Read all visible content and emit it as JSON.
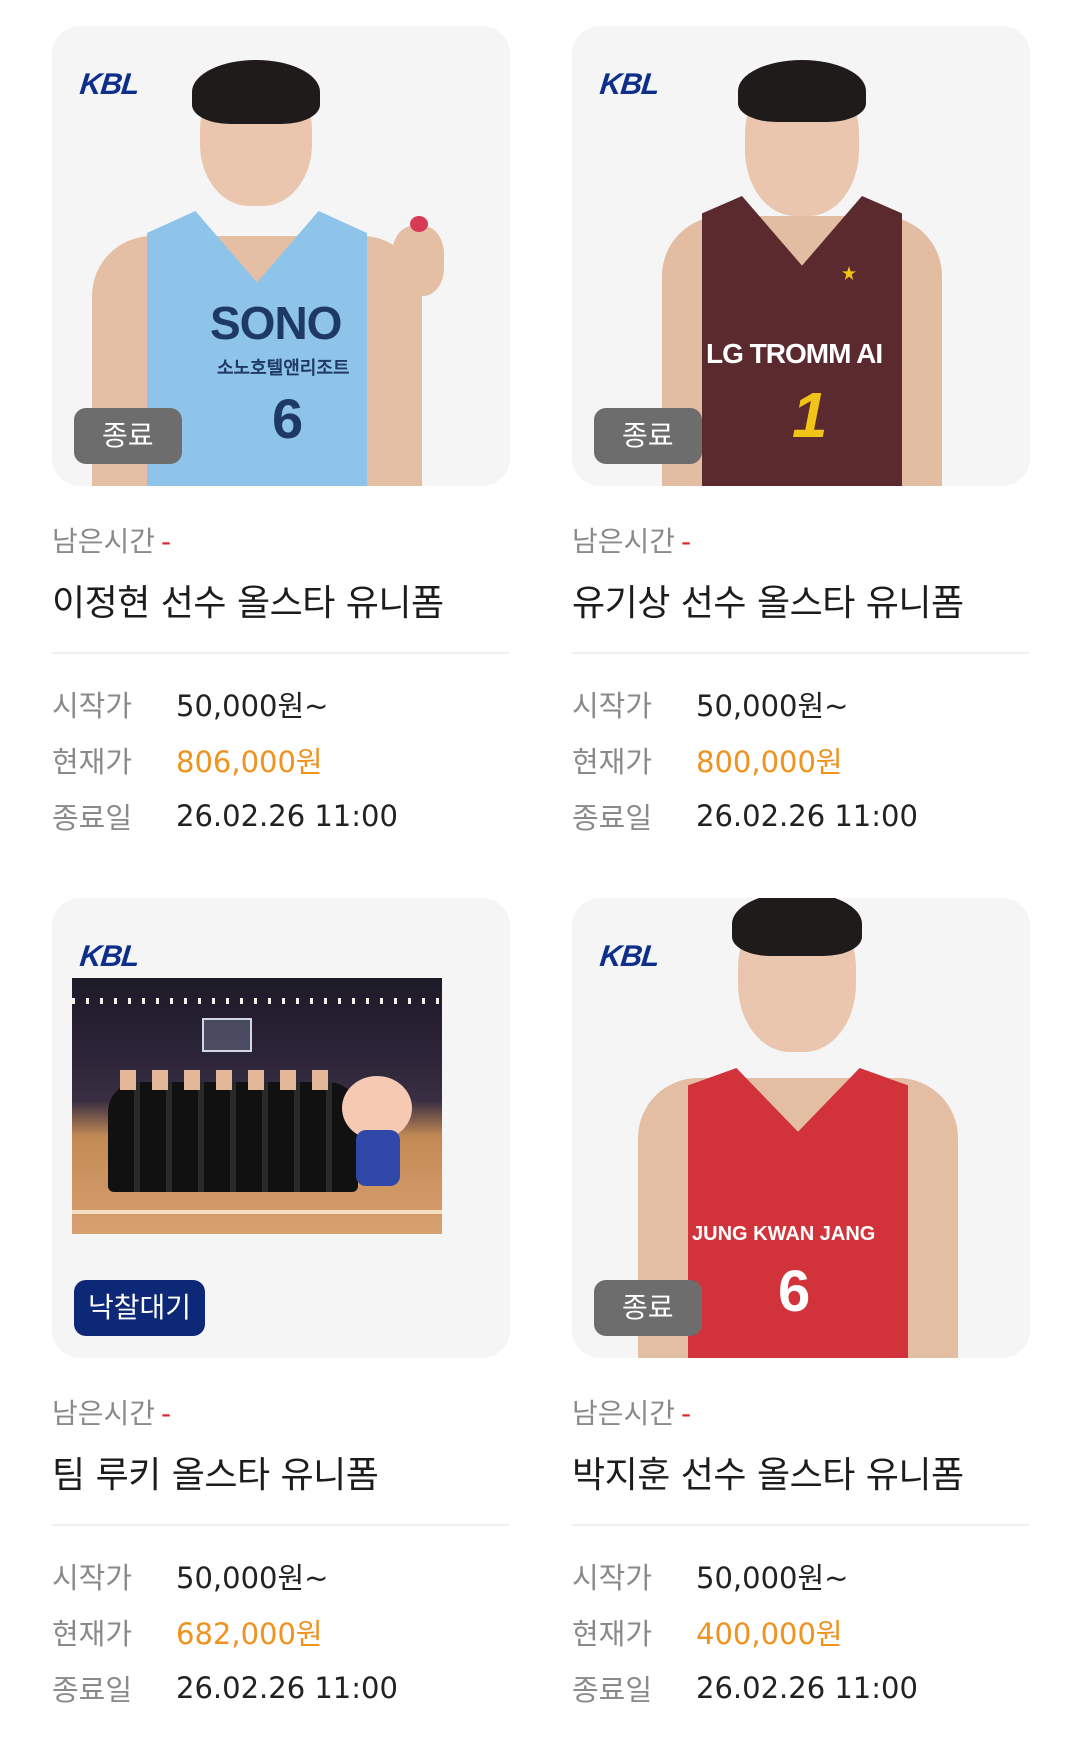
{
  "labels": {
    "remain": "남은시간",
    "remain_value": "-",
    "start_price": "시작가",
    "current_price": "현재가",
    "end_date": "종료일"
  },
  "logo_text": "KBL",
  "items": [
    {
      "badge": "종료",
      "title": "이정현 선수 올스타 유니폼",
      "start_price": "50,000원~",
      "current_price": "806,000원",
      "end_date": "26.02.26 11:00",
      "jersey_brand": "SONO",
      "jersey_sub": "소노호텔앤리조트",
      "jersey_number": "6",
      "jersey_color": "#8ec3ea"
    },
    {
      "badge": "종료",
      "title": "유기상 선수 올스타 유니폼",
      "start_price": "50,000원~",
      "current_price": "800,000원",
      "end_date": "26.02.26 11:00",
      "jersey_brand": "LG TROMM AI",
      "jersey_number": "1",
      "jersey_color": "#5a2a2e"
    },
    {
      "badge": "낙찰대기",
      "title": "팀 루키 올스타 유니폼",
      "start_price": "50,000원~",
      "current_price": "682,000원",
      "end_date": "26.02.26 11:00"
    },
    {
      "badge": "종료",
      "title": "박지훈 선수 올스타 유니폼",
      "start_price": "50,000원~",
      "current_price": "400,000원",
      "end_date": "26.02.26 11:00",
      "jersey_brand": "JUNG KWAN JANG",
      "jersey_number": "6",
      "jersey_color": "#d2333a"
    }
  ],
  "colors": {
    "price": "#f0921e",
    "badge_ended": "#6d6d6d",
    "badge_waiting": "#0d2877",
    "remain_dash": "#e0242a",
    "logo": "#0d2f8a"
  }
}
